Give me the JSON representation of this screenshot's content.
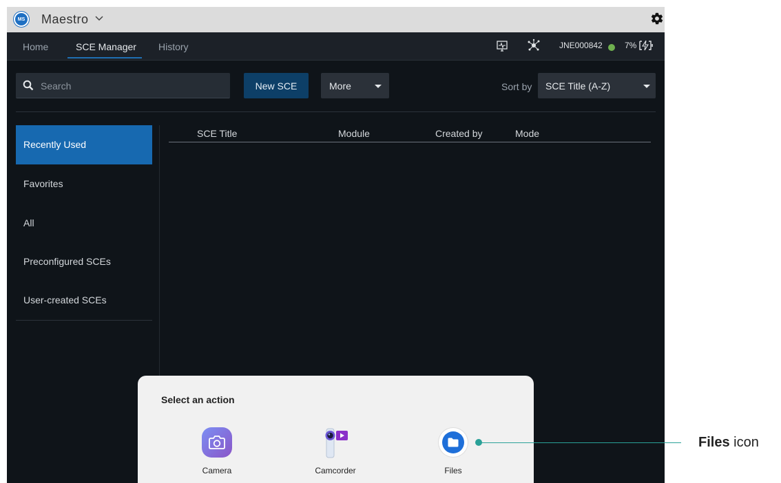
{
  "app": {
    "logo_text": "MS",
    "name": "Maestro"
  },
  "nav": {
    "tabs": [
      {
        "label": "Home",
        "active": false
      },
      {
        "label": "SCE Manager",
        "active": true
      },
      {
        "label": "History",
        "active": false
      }
    ],
    "device_id": "JNE000842",
    "device_status_color": "#6fb04f",
    "battery_percent": "7%"
  },
  "toolbar": {
    "search_placeholder": "Search",
    "new_label": "New SCE",
    "more_label": "More",
    "sort_label": "Sort by",
    "sort_value": "SCE Title (A-Z)"
  },
  "sidebar": {
    "items": [
      {
        "label": "Recently Used",
        "active": true
      },
      {
        "label": "Favorites",
        "active": false
      },
      {
        "label": "All",
        "active": false
      },
      {
        "label": "Preconfigured SCEs",
        "active": false
      },
      {
        "label": "User-created SCEs",
        "active": false
      }
    ]
  },
  "table": {
    "columns": [
      "SCE Title",
      "Module",
      "Created by",
      "Mode"
    ],
    "rows": []
  },
  "action_sheet": {
    "title": "Select an action",
    "actions": [
      {
        "label": "Camera",
        "icon": "camera-icon"
      },
      {
        "label": "Camcorder",
        "icon": "camcorder-icon"
      },
      {
        "label": "Files",
        "icon": "folder-icon"
      }
    ]
  },
  "callout": {
    "bold": "Files",
    "rest": " icon",
    "color": "#2aa198"
  },
  "colors": {
    "accent": "#1769b0",
    "primary_button": "#0d3f67",
    "background": "#0f1419"
  }
}
